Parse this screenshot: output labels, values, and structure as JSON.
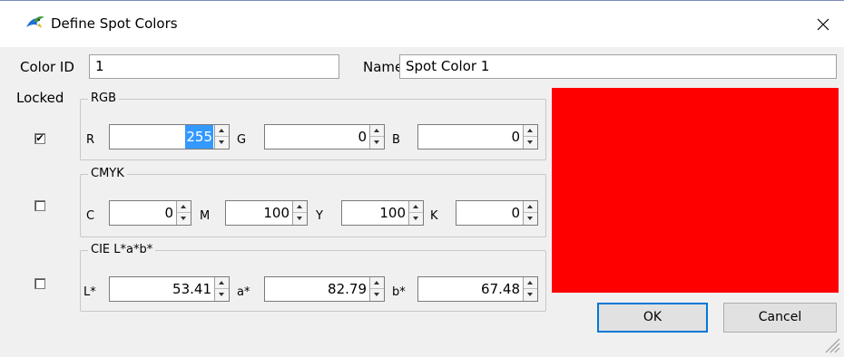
{
  "window": {
    "title": "Define Spot Colors",
    "close_glyph": "✕"
  },
  "header": {
    "color_id_label": "Color ID",
    "color_id_value": "1",
    "name_label": "Name",
    "name_value": "Spot Color 1"
  },
  "locked_label": "Locked",
  "groups": {
    "rgb": {
      "title": "RGB",
      "checked": true,
      "check_glyph": "✔",
      "r_label": "R",
      "r_value": "255",
      "g_label": "G",
      "g_value": "0",
      "b_label": "B",
      "b_value": "0"
    },
    "cmyk": {
      "title": "CMYK",
      "checked": false,
      "c_label": "C",
      "c_value": "0",
      "m_label": "M",
      "m_value": "100",
      "y_label": "Y",
      "y_value": "100",
      "k_label": "K",
      "k_value": "0"
    },
    "lab": {
      "title": "CIE L*a*b*",
      "checked": false,
      "l_label": "L*",
      "l_value": "53.41",
      "a_label": "a*",
      "a_value": "82.79",
      "b_label": "b*",
      "b_value": "67.48"
    }
  },
  "preview_color": "#ff0000",
  "buttons": {
    "ok": "OK",
    "cancel": "Cancel"
  },
  "icons": {
    "app": "app-bird-icon",
    "close": "close-icon",
    "grip": "resize-grip-icon"
  }
}
